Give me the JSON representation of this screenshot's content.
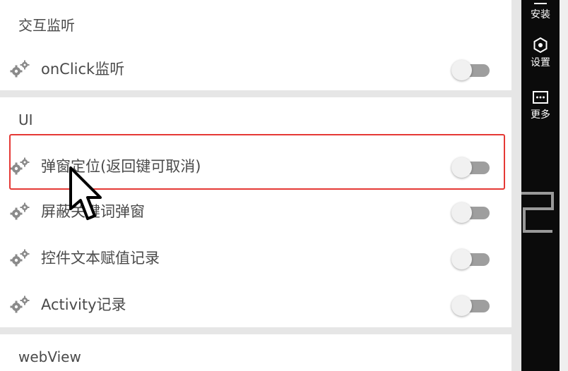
{
  "sections": [
    {
      "title": "交互监听",
      "items": [
        {
          "label": "onClick监听",
          "enabled": false
        }
      ]
    },
    {
      "title": "UI",
      "items": [
        {
          "label": "弹窗定位(返回键可取消)",
          "enabled": false
        },
        {
          "label": "屏蔽关键词弹窗",
          "enabled": false
        },
        {
          "label": "控件文本赋值记录",
          "enabled": false
        },
        {
          "label": "Activity记录",
          "enabled": false
        }
      ]
    },
    {
      "title": "webView",
      "items": []
    }
  ],
  "sidebar": {
    "install_label": "安装",
    "settings_label": "设置",
    "more_label": "更多"
  },
  "colors": {
    "highlight_border": "#e53935",
    "sidebar_bg": "#0b0b0b",
    "toggle_track_off": "#9e9e9e",
    "toggle_thumb_off": "#f1f1f1"
  },
  "icons": {
    "item_icon": "gears-icon",
    "settings_icon": "hexagon-settings-icon",
    "more_icon": "ellipsis-box-icon"
  }
}
